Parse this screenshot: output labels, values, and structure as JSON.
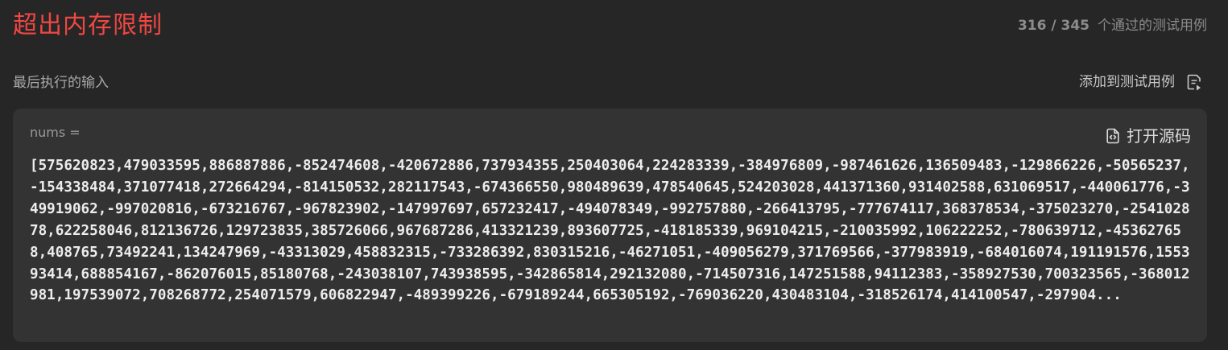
{
  "header": {
    "status": "超出内存限制",
    "passed": "316",
    "separator": " / ",
    "total": "345",
    "passed_suffix": "个通过的测试用例"
  },
  "last_input": {
    "label": "最后执行的输入",
    "add_button_label": "添加到测试用例",
    "add_button_icon": "file-add-icon"
  },
  "input_card": {
    "variable_label": "nums =",
    "open_source_label": "打开源码",
    "open_source_icon": "file-code-icon",
    "value": "[575620823,479033595,886887886,-852474608,-420672886,737934355,250403064,224283339,-384976809,-987461626,136509483,-129866226,-50565237,-154338484,371077418,272664294,-814150532,282117543,-674366550,980489639,478540645,524203028,441371360,931402588,631069517,-440061776,-349919062,-997020816,-673216767,-967823902,-147997697,657232417,-494078349,-992757880,-266413795,-777674117,368378534,-375023270,-254102878,622258046,812136726,129723835,385726066,967687286,413321239,893607725,-418185339,969104215,-210035992,106222252,-780639712,-453627658,408765,73492241,134247969,-43313029,458832315,-733286392,830315216,-46271051,-409056279,371769566,-377983919,-684016074,191191576,155393414,688854167,-862076015,85180768,-243038107,743938595,-342865814,292132080,-714507316,147251588,94112383,-358927530,700323565,-368012981,197539072,708268772,254071579,606822947,-489399226,-679189244,665305192,-769036220,430483104,-318526174,414100547,-297904..."
  },
  "colors": {
    "background": "#262626",
    "card": "#333333",
    "error": "#ef4743"
  }
}
